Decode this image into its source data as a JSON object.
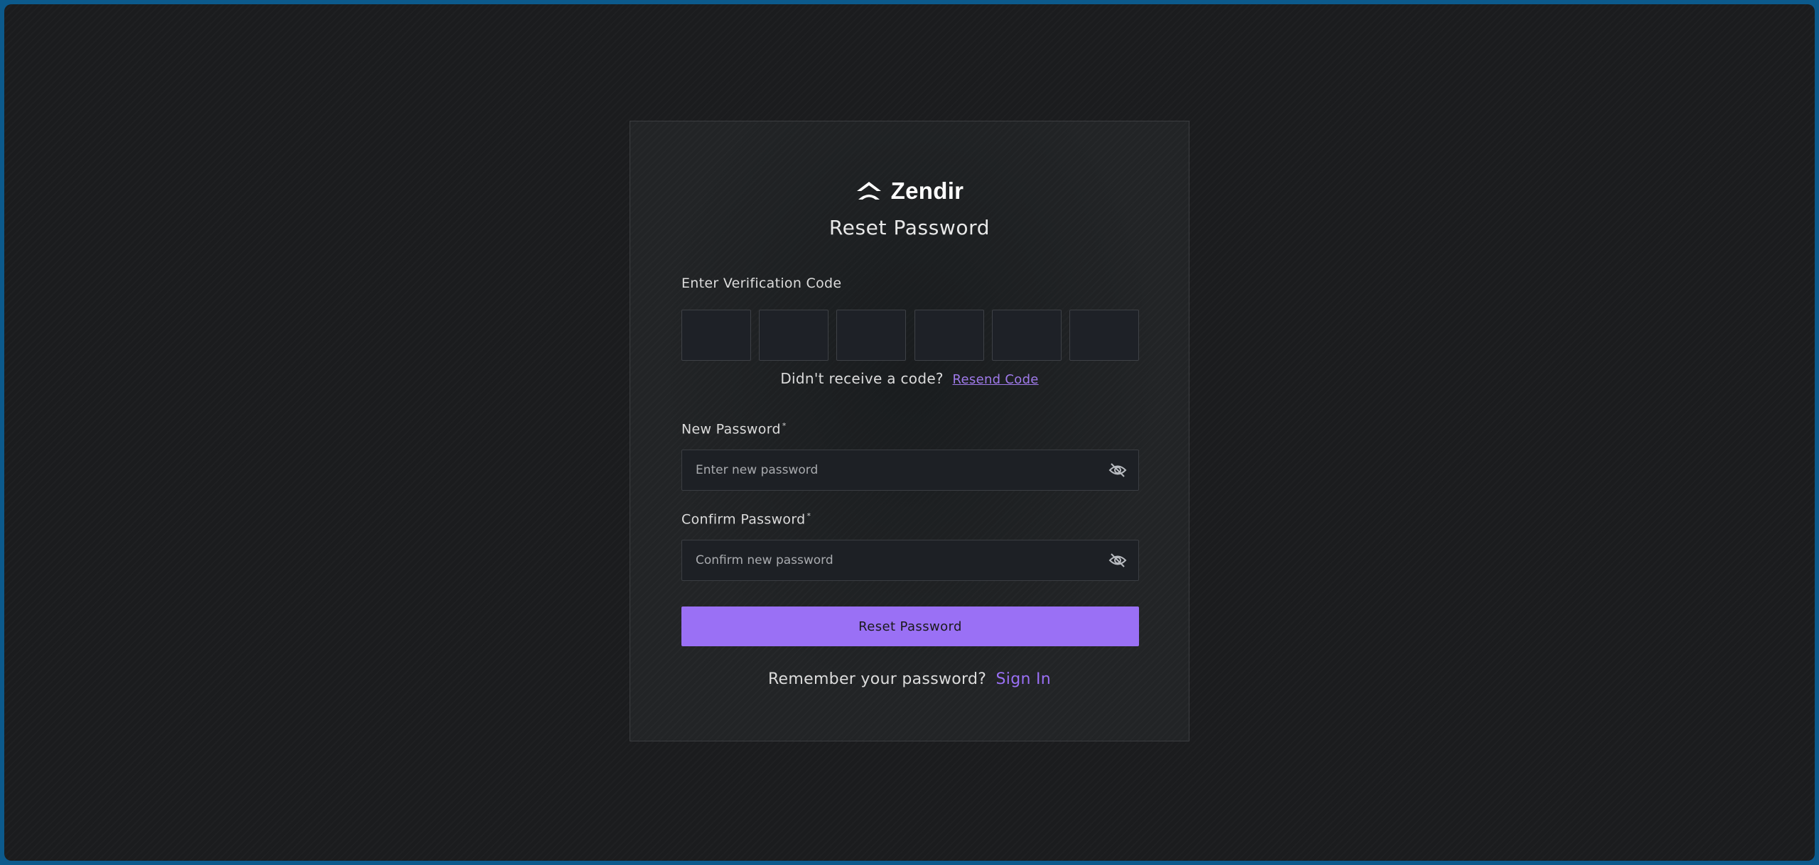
{
  "brand": {
    "name": "Zendir",
    "logo_icon": "zendir-logo-icon"
  },
  "form": {
    "title": "Reset Password",
    "verification": {
      "label": "Enter Verification Code",
      "code_boxes": [
        "",
        "",
        "",
        "",
        "",
        ""
      ],
      "resend_prompt": "Didn't receive a code?",
      "resend_link": "Resend Code"
    },
    "new_password": {
      "label": "New Password",
      "required_mark": "*",
      "placeholder": "Enter new password",
      "value": "",
      "toggle_icon": "eye-off-icon"
    },
    "confirm_password": {
      "label": "Confirm Password",
      "required_mark": "*",
      "placeholder": "Confirm new password",
      "value": "",
      "toggle_icon": "eye-off-icon"
    },
    "submit_label": "Reset Password",
    "signin_prompt": "Remember your password?",
    "signin_link": "Sign In"
  },
  "colors": {
    "accent": "#9a70f5",
    "background": "#1b1c1e",
    "frame_border": "#0c5a8c"
  }
}
